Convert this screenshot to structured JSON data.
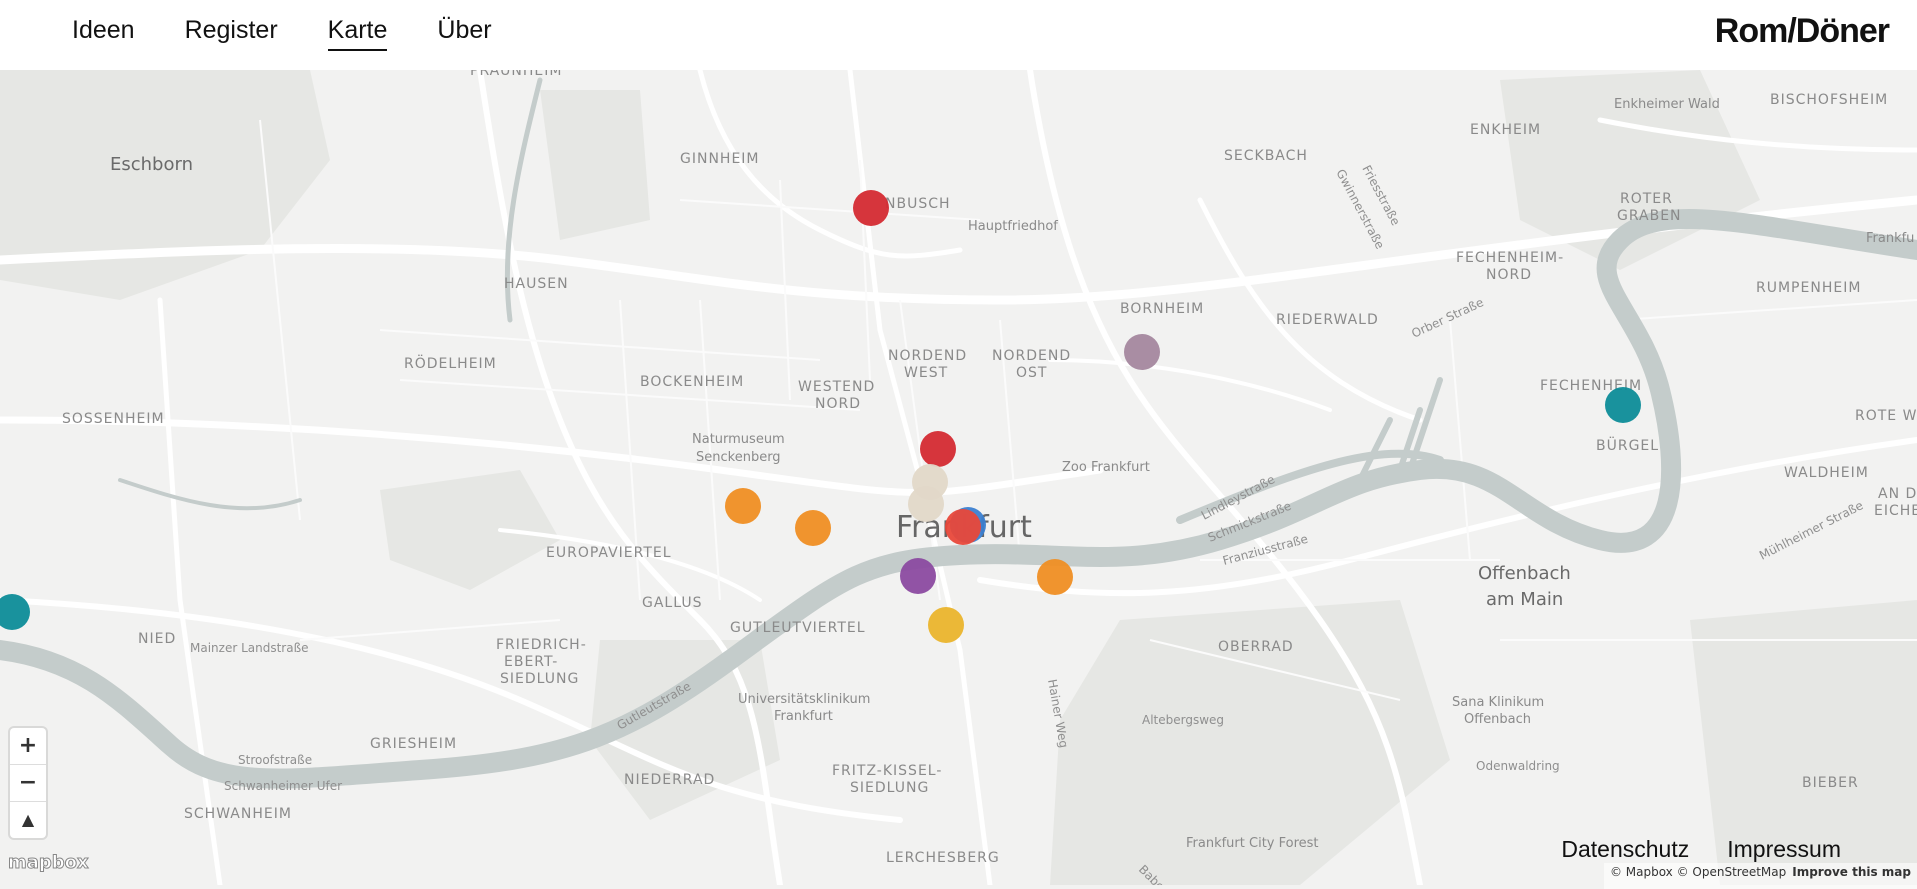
{
  "nav": {
    "items": [
      {
        "label": "Ideen",
        "active": false
      },
      {
        "label": "Register",
        "active": false
      },
      {
        "label": "Karte",
        "active": true
      },
      {
        "label": "Über",
        "active": false
      }
    ]
  },
  "brand": "Rom/Döner",
  "map": {
    "labels": {
      "eschborn": "Eschborn",
      "ginnheim": "GINNHEIM",
      "dornbusch": "NBUSCH",
      "hauptfriedhof": "Hauptfriedhof",
      "seckbach": "SECKBACH",
      "enkheim": "ENKHEIM",
      "enkheimer_wald": "Enkheimer Wald",
      "bischofsheim": "BISCHOFSHEIM",
      "roter_graben_1": "ROTER",
      "roter_graben_2": "GRABEN",
      "frankfurt_edge": "Frankfu",
      "hausen": "HAUSEN",
      "roedelheim": "RÖDELHEIM",
      "bornheim": "BORNHEIM",
      "riederwald": "RIEDERWALD",
      "fechenheim_nord_1": "FECHENHEIM-",
      "fechenheim_nord_2": "NORD",
      "rumpenheim": "RUMPENHEIM",
      "sossenheim": "SOSSENHEIM",
      "bockenheim": "BOCKENHEIM",
      "nordend_west_1": "NORDEND",
      "nordend_west_2": "WEST",
      "nordend_ost_1": "NORDEND",
      "nordend_ost_2": "OST",
      "westend_nord_1": "WESTEND",
      "westend_nord_2": "NORD",
      "fechenheim": "FECHENHEIM",
      "rote_edge": "ROTE W",
      "naturmuseum_1": "Naturmuseum",
      "naturmuseum_2": "Senckenberg",
      "zoo": "Zoo Frankfurt",
      "buergel": "BÜRGEL",
      "waldheim": "WALDHEIM",
      "frankfurt": "Frankfurt",
      "europaviertel": "EUROPAVIERTEL",
      "offenbach_1": "Offenbach",
      "offenbach_2": "am Main",
      "an_der_1": "AN DE",
      "an_der_2": "EICHE",
      "gallus": "GALLUS",
      "gutleutviertel": "GUTLEUTVIERTEL",
      "nied": "NIED",
      "mainzer_landstrasse": "Mainzer Landstraße",
      "friedrich_1": "FRIEDRICH-",
      "friedrich_2": "EBERT-",
      "friedrich_3": "SIEDLUNG",
      "oberrad": "OBERRAD",
      "uniklinikum_1": "Universitätsklinikum",
      "uniklinikum_2": "Frankfurt",
      "sana_1": "Sana Klinikum",
      "sana_2": "Offenbach",
      "griesheim": "GRIESHEIM",
      "stroofstrasse": "Stroofstraße",
      "schwanheimer_ufer": "Schwanheimer Ufer",
      "niederrad": "NIEDERRAD",
      "fritz_1": "FRITZ-KISSEL-",
      "fritz_2": "SIEDLUNG",
      "odenwaldring": "Odenwaldring",
      "schwanheim": "SCHWANHEIM",
      "bieber": "BIEBER",
      "lerchesberg": "LERCHESBERG",
      "city_forest": "Frankfurt City Forest",
      "altebergsweg": "Altebergsweg",
      "gutleutstrasse": "Gutleutstraße",
      "hainer_weg": "Hainer Weg",
      "friesstrasse": "Friesstraße",
      "gwinnerstrasse": "Gwinnerstraße",
      "orber_strasse": "Orber Straße",
      "lindleystrasse": "Lindleystraße",
      "schmickstrasse": "Schmickstraße",
      "franziusstrasse": "Franziusstraße",
      "muehlheimer_strasse": "Mühlheimer Straße",
      "praunheim": "PRAUNHEIM",
      "babenh": "Babe"
    },
    "markers": [
      {
        "name": "marker-1",
        "color": "#d42a32"
      },
      {
        "name": "marker-2",
        "color": "#a4879e"
      },
      {
        "name": "marker-3",
        "color": "#0d8c98"
      },
      {
        "name": "marker-4",
        "color": "#d42a32"
      },
      {
        "name": "marker-5",
        "color": "#e2d8c8"
      },
      {
        "name": "marker-6",
        "color": "#e2d8c8"
      },
      {
        "name": "marker-7",
        "color": "#3b7fd0"
      },
      {
        "name": "marker-8",
        "color": "#e8483a"
      },
      {
        "name": "marker-9",
        "color": "#ef8e23"
      },
      {
        "name": "marker-10",
        "color": "#ef8e23"
      },
      {
        "name": "marker-11",
        "color": "#8b4aa0"
      },
      {
        "name": "marker-12",
        "color": "#ef8e23"
      },
      {
        "name": "marker-13",
        "color": "#eab42c"
      },
      {
        "name": "marker-14",
        "color": "#0d8c98"
      }
    ],
    "controls": {
      "zoom_in": "+",
      "zoom_out": "−",
      "compass": "▲"
    },
    "logo": "mapbox"
  },
  "footer": {
    "links": [
      "Datenschutz",
      "Impressum"
    ],
    "attribution": "© Mapbox © OpenStreetMap",
    "improve": "Improve this map"
  }
}
